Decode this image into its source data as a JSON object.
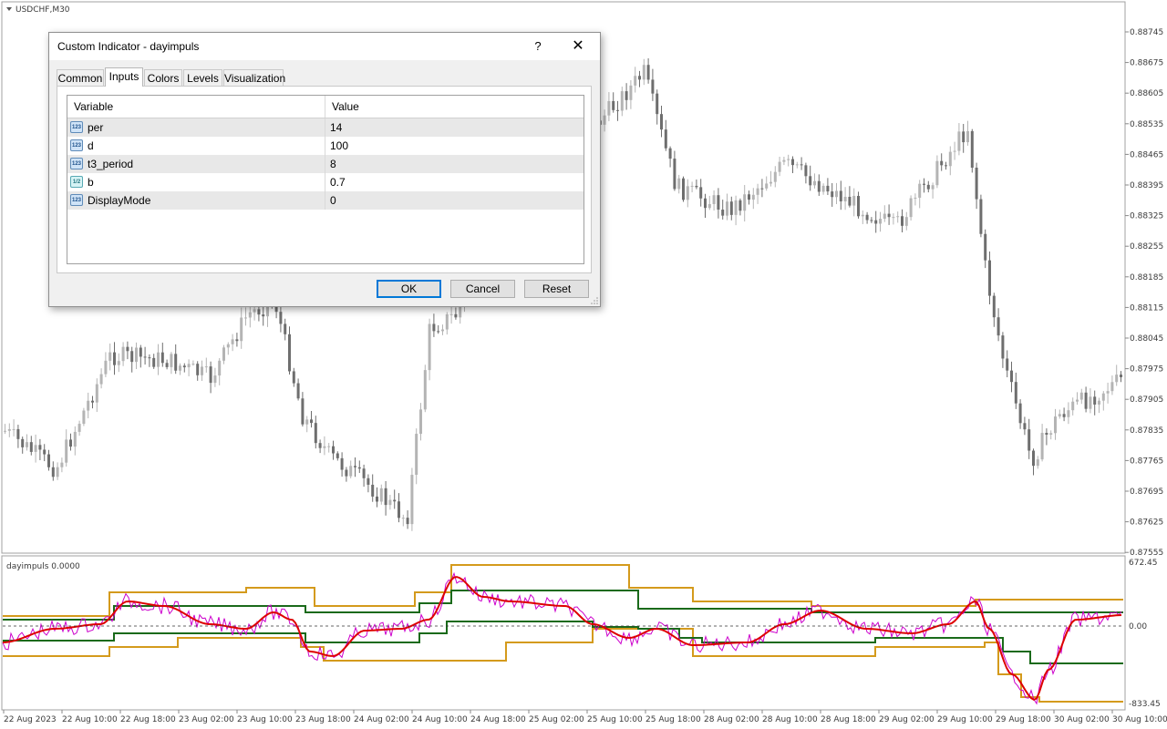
{
  "chart": {
    "title": "USDCHF,M30",
    "price_labels": [
      "0.88745",
      "0.88675",
      "0.88605",
      "0.88535",
      "0.88465",
      "0.88395",
      "0.88325",
      "0.88255",
      "0.88185",
      "0.88115",
      "0.88045",
      "0.87975",
      "0.87905",
      "0.87835",
      "0.87765",
      "0.87695",
      "0.87625",
      "0.87555"
    ],
    "time_labels": [
      "22 Aug 2023",
      "22 Aug 10:00",
      "22 Aug 18:00",
      "23 Aug 02:00",
      "23 Aug 10:00",
      "23 Aug 18:00",
      "24 Aug 02:00",
      "24 Aug 10:00",
      "24 Aug 18:00",
      "25 Aug 02:00",
      "25 Aug 10:00",
      "25 Aug 18:00",
      "28 Aug 02:00",
      "28 Aug 10:00",
      "28 Aug 18:00",
      "29 Aug 02:00",
      "29 Aug 10:00",
      "29 Aug 18:00",
      "30 Aug 02:00",
      "30 Aug 10:00"
    ],
    "colors": {
      "bull": "#b4b4b4",
      "bear": "#6e6e6e"
    }
  },
  "indicator": {
    "title": "dayimpuls 0.0000",
    "scale_labels": [
      "672.45",
      "0.00",
      "-833.45"
    ],
    "colors": {
      "fast": "#cc00cc",
      "smooth": "#dd0000",
      "inner_band": "#1a6a1a",
      "outer_band": "#d49a1c"
    }
  },
  "dialog": {
    "title": "Custom Indicator - dayimpuls",
    "help_label": "?",
    "close_label": "✕",
    "tabs": [
      "Common",
      "Inputs",
      "Colors",
      "Levels",
      "Visualization"
    ],
    "active_tab": "Inputs",
    "columns": [
      "Variable",
      "Value"
    ],
    "rows": [
      {
        "icon": "123",
        "name": "per",
        "value": "14"
      },
      {
        "icon": "123",
        "name": "d",
        "value": "100"
      },
      {
        "icon": "123",
        "name": "t3_period",
        "value": "8"
      },
      {
        "icon": "1/2",
        "name": "b",
        "value": "0.7"
      },
      {
        "icon": "123",
        "name": "DisplayMode",
        "value": "0"
      }
    ],
    "buttons": {
      "ok": "OK",
      "cancel": "Cancel",
      "reset": "Reset"
    }
  }
}
